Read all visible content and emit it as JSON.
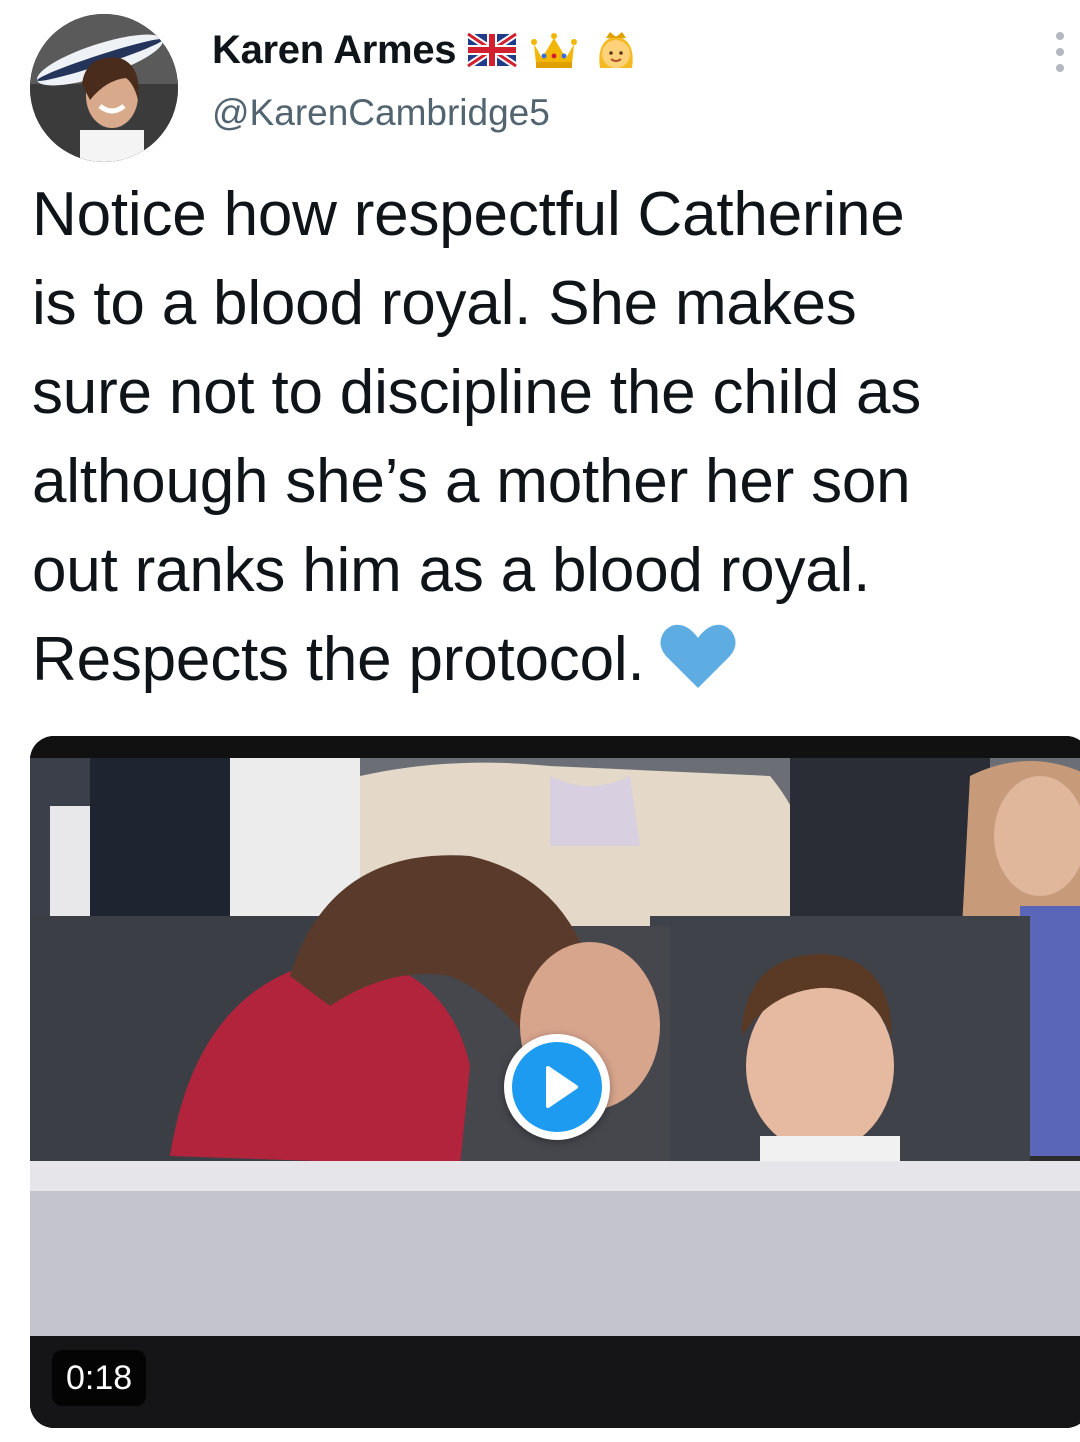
{
  "tweet": {
    "display_name": "Karen Armes",
    "name_emojis": [
      "uk-flag-icon",
      "crown-icon",
      "princess-icon"
    ],
    "handle": "@KarenCambridge5",
    "text_lines": [
      "Notice how respectful Catherine",
      "is to a blood royal.  She makes",
      "sure not to discipline the child as",
      "although she’s a mother her son",
      "out ranks him as a blood royal.",
      "Respects the protocol."
    ],
    "heart_color": "#5dade2"
  },
  "media": {
    "type": "video",
    "duration": "0:18",
    "play_color": "#1d9bf0"
  }
}
